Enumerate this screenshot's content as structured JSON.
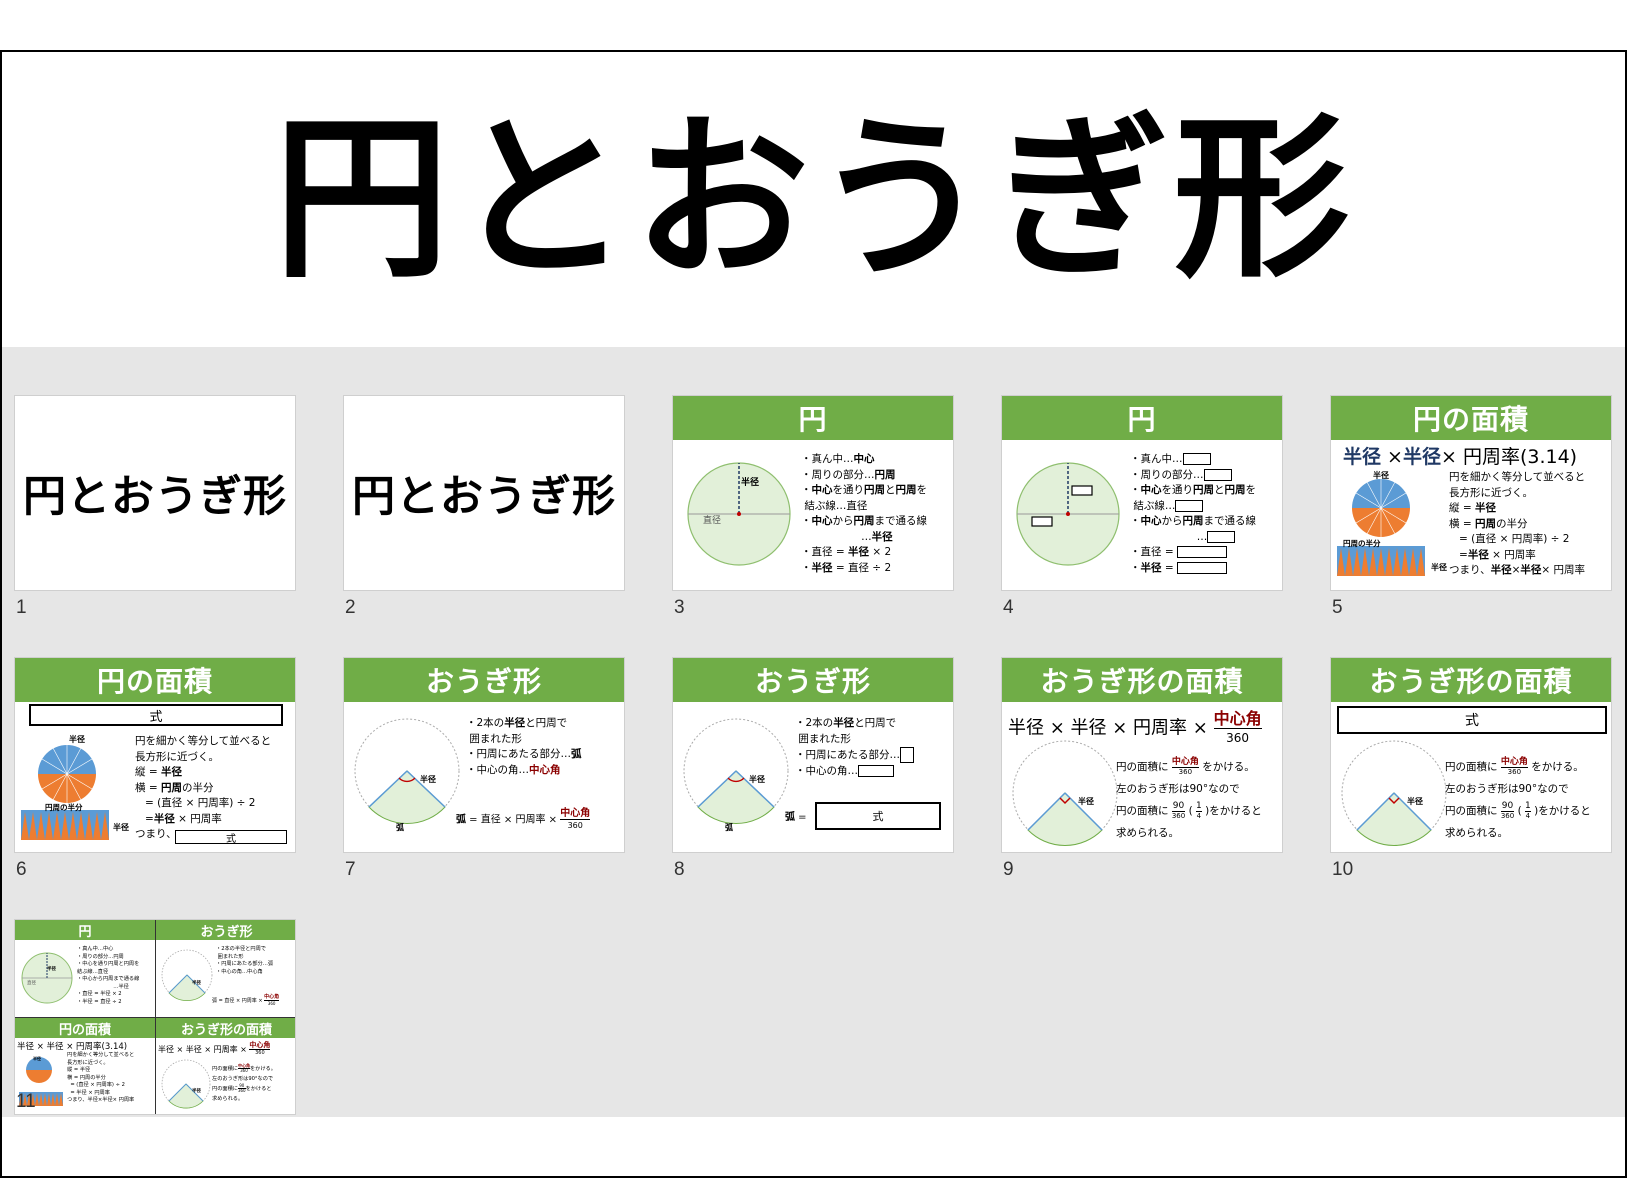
{
  "page_title": "円とおうぎ形",
  "slides": [
    {
      "num": "1",
      "title": "円とおうぎ形"
    },
    {
      "num": "2",
      "title": "円とおうぎ形"
    },
    {
      "num": "3",
      "header": "円",
      "lines": [
        "・真ん中…",
        "中心",
        "・周りの部分…",
        "円周",
        "・",
        "中心",
        "を通り",
        "円周",
        "と",
        "円周",
        "を",
        "結ぶ線…直径",
        "・",
        "中心",
        "から",
        "円周",
        "まで通る線",
        "…",
        "半径",
        "・直径 = ",
        "半径",
        " × 2",
        "・",
        "半径",
        " = 直径 ÷ 2"
      ],
      "radius_label": "半径",
      "diameter_label": "直径"
    },
    {
      "num": "4",
      "header": "円",
      "lines": [
        "・真ん中…",
        "・周りの部分…",
        "・",
        "中心",
        "を通り",
        "円周",
        "と",
        "円周",
        "を",
        "結ぶ線…",
        "・",
        "中心",
        "から",
        "円周",
        "まで通る線",
        "…",
        "・直径 = ",
        "・",
        "半径",
        " = "
      ]
    },
    {
      "num": "5",
      "header": "円の面積",
      "formula": [
        "半径",
        " ×",
        "半径",
        "× 円周率(3.14)"
      ],
      "lines": [
        "円を細かく等分して並べると",
        "長方形に近づく。",
        "縦 = ",
        "半径",
        "横 = ",
        "円周",
        "の半分",
        "= (直径 × 円周率) ÷ 2",
        "=",
        "半径",
        " × 円周率",
        "つまり、",
        "半径",
        "×",
        "半径",
        "× 円周率"
      ],
      "radius_label": "半径",
      "half_label": "円周の半分"
    },
    {
      "num": "6",
      "header": "円の面積",
      "box_label": "式",
      "lines": [
        "円を細かく等分して並べると",
        "長方形に近づく。",
        "縦 = ",
        "半径",
        "横 = ",
        "円周",
        "の半分",
        "= (直径 × 円周率) ÷ 2",
        "=",
        "半径",
        " × 円周率",
        "つまり、"
      ],
      "box_label_2": "式",
      "radius_label": "半径",
      "half_label": "円周の半分"
    },
    {
      "num": "7",
      "header": "おうぎ形",
      "lines": [
        "・2本の",
        "半径",
        "と円周で",
        "囲まれた形",
        "・円周にあたる部分…",
        "弧",
        "・中心の角…",
        "中心角"
      ],
      "formula_left": "弧",
      "formula_mid": " = 直径 × 円周率 × ",
      "formula_frac_top": "中心角",
      "formula_frac_bottom": "360",
      "radius_label": "半径",
      "arc_label": "弧"
    },
    {
      "num": "8",
      "header": "おうぎ形",
      "lines": [
        "・2本の",
        "半径",
        "と円周で",
        "囲まれた形",
        "・円周にあたる部分…",
        "・中心の角…"
      ],
      "formula_left": "弧",
      "formula_eq": " =",
      "box_label": "式",
      "radius_label": "半径",
      "arc_label": "弧"
    },
    {
      "num": "9",
      "header": "おうぎ形の面積",
      "formula": "半径 × 半径 × 円周率 × ",
      "frac_top": "中心角",
      "frac_bottom": "360",
      "lines": [
        "円の面積に",
        "をかける。",
        "左のおうぎ形は90°なので",
        "円の面積に",
        "(",
        ")",
        "をかけると",
        "求められる。"
      ],
      "f1_top": "中心角",
      "f1_bottom": "360",
      "f2_top": "90",
      "f2_bottom": "360",
      "f3_top": "1",
      "f3_bottom": "4",
      "radius_label": "半径"
    },
    {
      "num": "10",
      "header": "おうぎ形の面積",
      "box_label": "式",
      "lines": [
        "円の面積に",
        "をかける。",
        "左のおうぎ形は90°なので",
        "円の面積に",
        "(",
        ")",
        "をかけると",
        "求められる。"
      ],
      "f1_top": "中心角",
      "f1_bottom": "360",
      "f2_top": "90",
      "f2_bottom": "360",
      "f3_top": "1",
      "f3_bottom": "4",
      "radius_label": "半径"
    },
    {
      "num": "11",
      "quad_headers": [
        "円",
        "おうぎ形",
        "円の面積",
        "おうぎ形の面積"
      ],
      "q1_lines": [
        "・真ん中…中心",
        "・周りの部分…円周",
        "・中心を通り円周と円周を",
        "結ぶ線…直径",
        "・中心から円周まで通る線",
        "…半径",
        "・直径 = 半径 × 2",
        "・半径 = 直径 ÷ 2"
      ],
      "q2_lines": [
        "・2本の半径と円周で",
        "囲まれた形",
        "・円周にあたる部分…弧",
        "・中心の角…中心角"
      ],
      "q2_formula": "弧 = 直径 × 円周率 × ",
      "q2_frac_top": "中心角",
      "q2_frac_bottom": "360",
      "q3_formula": "半径 × 半径 × 円周率(3.14)",
      "q3_lines": [
        "円を細かく等分して並べると",
        "長方形に近づく。",
        "縦 = 半径",
        "横 = 円周の半分",
        "= (直径 × 円周率) ÷ 2",
        "= 半径 × 円周率",
        "つまり、半径×半径× 円周率"
      ],
      "q4_formula": "半径 × 半径 × 円周率 × ",
      "q4_frac_top": "中心角",
      "q4_frac_bottom": "360",
      "q4_lines": [
        "円の面積に",
        "をかける。",
        "左のおうぎ形は90°なので",
        "円の面積に",
        "をかけると",
        "求められる。"
      ],
      "q4_f1_top": "中心角",
      "q4_f1_bottom": "360",
      "q4_f2_top": "90",
      "q4_f2_bottom": "360",
      "q1_radius_label": "半径",
      "q1_diameter_label": "直径",
      "q2_radius_label": "半径",
      "q3_radius_label": "半径",
      "q4_radius_label": "半径"
    }
  ],
  "colors": {
    "header_green": "#70ad47",
    "circle_fill": "#e2f0d9",
    "sector_fill": "#e2f0d9",
    "navy": "#1f3864",
    "dark_red": "#8b0000",
    "grid_bg": "#e6e6e6"
  }
}
